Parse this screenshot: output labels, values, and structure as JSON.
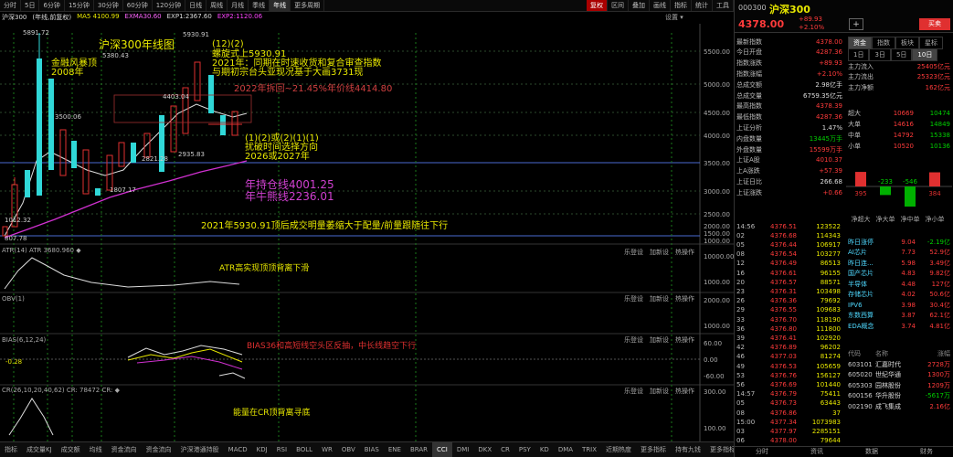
{
  "toolbar": {
    "items": [
      "分时",
      "5日",
      "6分钟",
      "15分钟",
      "30分钟",
      "60分钟",
      "120分钟",
      "日线",
      "周线",
      "月线",
      "季线",
      "年线",
      "更多周期"
    ],
    "active_index": 11,
    "right_items": [
      "复权",
      "区间",
      "叠加",
      "画线",
      "指标",
      "统计",
      "工具"
    ],
    "right_red_index": 0
  },
  "legend": {
    "name": "沪深300",
    "period": "(年线,前复权)",
    "ma5": "MA5 4100.99",
    "ma10": "EXMA30.60",
    "exp": "EXP1:2367.60",
    "exp2": "EXP2:1120.06"
  },
  "setting": "设置 ▾",
  "price_axis": [
    "5500.00",
    "5000.00",
    "4500.00",
    "4000.00",
    "3500.00",
    "3000.00",
    "2500.00",
    "2000.00",
    "1500.00",
    "1000.00"
  ],
  "main_annotations": {
    "title": "沪深300年线图",
    "t1": "(12)(2)",
    "t2": "螺旋式上5930.91",
    "t3": "2021年：同期在时速收货和复合审查指数",
    "t4": "与期初宗台头亚现况基于大画3731现",
    "t5": "2022年拆回~21.45%年价线4414.80",
    "t6": "(1)(2)或(2)(1)(1)",
    "t7": "扰破时间选择方向",
    "t8": "2026或2027年",
    "t9": "年持仓线4001.25",
    "t10": "年牛熊线2236.01",
    "t11": "2021年5930.91顶后成交明量萎缩大于配量/前量跟随往下行",
    "l1": "金融风暴顶",
    "l2": "2008年",
    "p1": "5891.72",
    "p2": "5380.43",
    "p3": "5930.91",
    "p4": "4403.04",
    "p5": "3500.06",
    "p6": "2821.28",
    "p7": "2935.83",
    "p8": "1807.17",
    "p9": "807.78",
    "p10": "1012.32"
  },
  "panel_btns": [
    "乐登设",
    "加新设",
    "热操作"
  ],
  "atr": {
    "name": "ATR(14) ATR 3680.960 ◆",
    "note": "ATR高实现顶顶背离下滑",
    "axis": [
      "10000.00",
      "1000.00"
    ]
  },
  "obv": {
    "name": "OBV(1)",
    "axis": [
      "2000.00",
      "1000.00"
    ]
  },
  "bias": {
    "name": "BIAS(6,12,24)",
    "val": "-0.28",
    "note": "BIAS36和高短线空头区反抽，中长线趋空下行",
    "axis": [
      "60.00",
      "0.00",
      "-60.00"
    ]
  },
  "cr": {
    "name": "CR(26,10,20,40,62) CR: 78472 CR: ◆",
    "note": "能量在CR顶背离寻底",
    "axis": [
      "300.00",
      "100.00"
    ]
  },
  "bottom_tabs": [
    "指标",
    "成交量KJ",
    "成交额",
    "均线",
    "资金流向",
    "资金流向",
    "沪深港通持股",
    "MACD",
    "KDJ",
    "RSI",
    "BOLL",
    "WR",
    "OBV",
    "BIAS",
    "ENE",
    "BRAR",
    "CCI",
    "DMI",
    "DKX",
    "CR",
    "PSY",
    "KD",
    "DMA",
    "TRIX",
    "近期热度",
    "更多指标",
    "持有九钱",
    "更多指标",
    "资金博弈",
    "视频"
  ],
  "bottom_active_index": 16,
  "rp": {
    "code": "000300",
    "name": "沪深300",
    "price": "4378.00",
    "chg": "+89.93",
    "pct": "+2.10%",
    "plus_icon": "+",
    "labels": {
      "new": "最新指数",
      "open": "今日开盘",
      "chg": "指数涨跌",
      "pct": "指数涨幅",
      "amt": "总成交额",
      "vol": "总成交量",
      "high": "最高指数",
      "low": "最低指数",
      "ratio": "上证分析",
      "inner": "内盘数量",
      "outer": "外盘数量",
      "up": "上证A股",
      "a": "上A涨跌",
      "b": "上证日比",
      "c": "上证涨跌"
    },
    "vals": {
      "new": "4378.00",
      "open": "4287.36",
      "chg": "+89.93",
      "pct": "+2.10%",
      "amt": "2.98亿手",
      "vol": "6759.35亿元",
      "high": "4378.39",
      "low": "4287.36",
      "ratio": "1.47%",
      "inner": "13445万手",
      "outer": "15599万手",
      "up": "4010.37",
      "a": "+57.39",
      "b": "266.68",
      "c": "+0.66"
    },
    "tabs_a": [
      "资金",
      "指数",
      "板块",
      "星标"
    ],
    "tabs_b": [
      "1日",
      "3日",
      "5日",
      "10日"
    ],
    "flow_labels": [
      "主力流入",
      "主力流出",
      "主力净额"
    ],
    "flow_vals": [
      "25405亿元",
      "25323亿元",
      "162亿元"
    ],
    "grid_labels": [
      "超大",
      "大单",
      "中单",
      "小单"
    ],
    "grid_in": [
      "10669",
      "14616",
      "14792",
      "10520"
    ],
    "grid_out": [
      "10474",
      "14849",
      "15338",
      "10136"
    ],
    "bars": {
      "values": [
        395,
        -233,
        -546,
        384
      ],
      "labels": [
        "净超大",
        "净大单",
        "净中单",
        "净小单"
      ]
    },
    "ticks": [
      [
        "14:56",
        "4376.51",
        "123522"
      ],
      [
        "02",
        "4376.68",
        "114343"
      ],
      [
        "05",
        "4376.44",
        "106917"
      ],
      [
        "08",
        "4376.54",
        "103277"
      ],
      [
        "12",
        "4376.49",
        "86513"
      ],
      [
        "16",
        "4376.61",
        "96155"
      ],
      [
        "20",
        "4376.57",
        "88571"
      ],
      [
        "23",
        "4376.31",
        "103498"
      ],
      [
        "26",
        "4376.36",
        "79692"
      ],
      [
        "29",
        "4376.55",
        "109683"
      ],
      [
        "33",
        "4376.70",
        "118190"
      ],
      [
        "36",
        "4376.80",
        "111800"
      ],
      [
        "39",
        "4376.41",
        "102920"
      ],
      [
        "42",
        "4376.89",
        "96202"
      ],
      [
        "46",
        "4377.03",
        "81274"
      ],
      [
        "49",
        "4376.53",
        "105659"
      ],
      [
        "53",
        "4376.76",
        "156127"
      ],
      [
        "56",
        "4376.69",
        "101440"
      ],
      [
        "14:57",
        "4376.79",
        "75411"
      ],
      [
        "05",
        "4376.73",
        "63443"
      ],
      [
        "08",
        "4376.86",
        "37"
      ],
      [
        "15:00",
        "4377.34",
        "1073983"
      ],
      [
        "03",
        "4377.97",
        "2285151"
      ],
      [
        "06",
        "4378.00",
        "79644"
      ]
    ],
    "sectors": [
      [
        "昨日涨停",
        "9.04",
        "-2.19亿"
      ],
      [
        "AI芯片",
        "7.73",
        "52.9亿"
      ],
      [
        "昨日连...",
        "5.98",
        "3.49亿"
      ],
      [
        "国产芯片",
        "4.83",
        "9.82亿"
      ],
      [
        "半导体",
        "4.48",
        "127亿"
      ],
      [
        "存储芯片",
        "4.02",
        "50.6亿"
      ],
      [
        "IPV6",
        "3.98",
        "30.4亿"
      ],
      [
        "东数西算",
        "3.87",
        "62.1亿"
      ],
      [
        "EDA概念",
        "3.74",
        "4.81亿"
      ]
    ],
    "stocks_hdr": [
      "代码",
      "名称",
      "涨幅"
    ],
    "stocks": [
      [
        "603101",
        "汇嘉时代",
        "2728万"
      ],
      [
        "605020",
        "世纪华通",
        "1300万"
      ],
      [
        "605303",
        "园林股份",
        "1209万"
      ],
      [
        "600156",
        "华升股份",
        "-5617万"
      ],
      [
        "002190",
        "成飞集成",
        "2.16亿"
      ]
    ],
    "small": [
      "分时",
      "资讯",
      "数据",
      "财务"
    ]
  }
}
